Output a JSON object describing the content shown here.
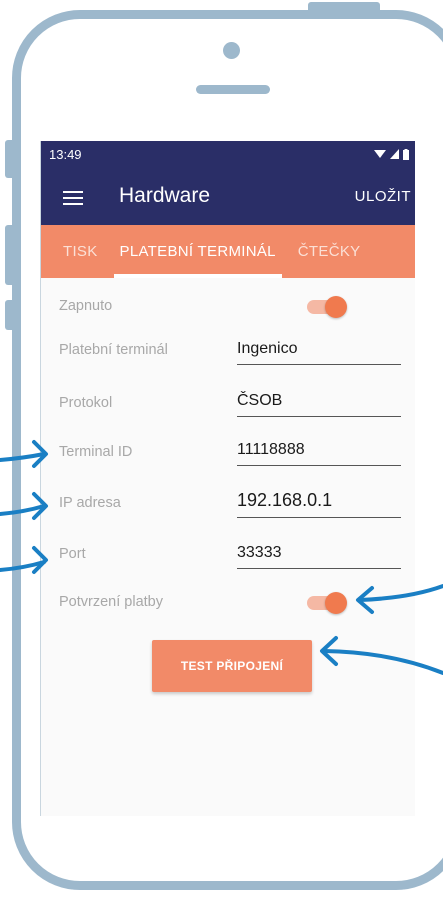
{
  "status_bar": {
    "time": "13:49"
  },
  "app_bar": {
    "title": "Hardware",
    "save_label": "ULOŽIT",
    "menu_icon": "hamburger-menu-icon"
  },
  "tabs": [
    {
      "label": "TISK",
      "active": false
    },
    {
      "label": "PLATEBNÍ TERMINÁL",
      "active": true
    },
    {
      "label": "ČTEČKY",
      "active": false
    }
  ],
  "form": {
    "enabled": {
      "label": "Zapnuto",
      "on": true
    },
    "terminal": {
      "label": "Platební terminál",
      "value": "Ingenico"
    },
    "protocol": {
      "label": "Protokol",
      "value": "ČSOB"
    },
    "terminal_id": {
      "label": "Terminal ID",
      "value": "11118888"
    },
    "ip": {
      "label": "IP adresa",
      "value": "192.168.0.1"
    },
    "port": {
      "label": "Port",
      "value": "33333"
    },
    "confirm": {
      "label": "Potvrzení platby",
      "on": true
    }
  },
  "test_button": {
    "label": "TEST PŘIPOJENÍ"
  },
  "colors": {
    "app_bar": "#2a2e67",
    "tab_bar": "#f28a68",
    "accent": "#f07a4e",
    "phone_frame": "#9db8cc",
    "annotation_arrow": "#1a7fc4"
  }
}
